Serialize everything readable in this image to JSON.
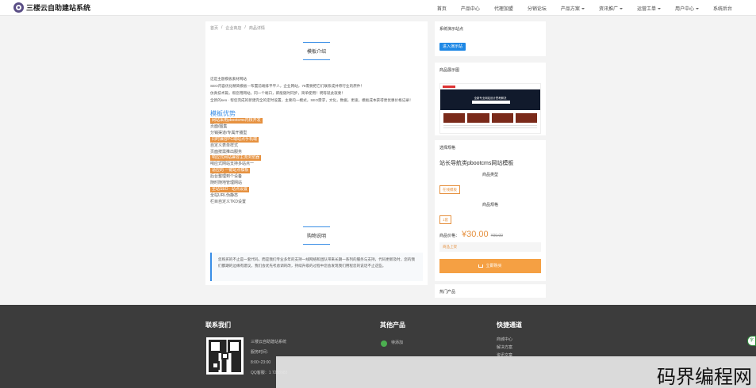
{
  "header": {
    "logo_text": "三楼云自助建站系统",
    "nav": [
      {
        "label": "首页",
        "dropdown": false
      },
      {
        "label": "产品中心",
        "dropdown": false
      },
      {
        "label": "代理加盟",
        "dropdown": false
      },
      {
        "label": "分销论坛",
        "dropdown": false
      },
      {
        "label": "产品方案",
        "dropdown": true
      },
      {
        "label": "资讯推广",
        "dropdown": true
      },
      {
        "label": "运营工单",
        "dropdown": true
      },
      {
        "label": "用户中心",
        "dropdown": true
      },
      {
        "label": "系统后台",
        "dropdown": false
      }
    ]
  },
  "breadcrumb": [
    "首页",
    "/",
    "企业商店",
    "/",
    "商品详情"
  ],
  "main": {
    "section1_title": "模板介绍",
    "intro_lines": [
      "这是主题模板素材网站",
      "SEO内容优化精简模板—布置前端排平平人，企业网站，75需要把它们联系成并称行业的原件！",
      "仿真技术篇，帮您用网站，同一个端口，即能随时同步，简单使用！明等就此就要！",
      "全新的seo · 帮您完成的新建完全的定时设置，主要的一模式，SEO需求，文化，数据，更速，模板成本获得更优惠价格记录！"
    ],
    "adv_title": "模板优势",
    "adv_items": [
      {
        "text": "网站采用pbootcms内核开发",
        "hl": true
      },
      {
        "text": "页面/图集",
        "hl": false
      },
      {
        "text": "分销渠道/专属开播型",
        "hl": false
      },
      {
        "text": "同时兼容PC端站点手机端",
        "hl": true
      },
      {
        "text": "自定义表单样式",
        "hl": false
      },
      {
        "text": "页面按需推出服务",
        "hl": false
      },
      {
        "text": "响应式网站兼容主流浏览器",
        "hl": true
      },
      {
        "text": "响应式网站支持多站点一",
        "hl": false
      },
      {
        "text": "适应的 一键站点模板",
        "hl": true
      },
      {
        "text": "后台整理到个设备",
        "hl": false
      },
      {
        "text": "随时随地管理网站",
        "hl": false
      },
      {
        "text": "全站SEO · 站点设置",
        "hl": true
      },
      {
        "text": "全站URL伪静态",
        "hl": false
      },
      {
        "text": "栏目自定义TKD设置",
        "hl": false
      }
    ],
    "section2_title": "购物说明",
    "notice_text": "您购买的不止是一套代码，而是我们专业多年的支持一线网络和团队带来长期一系列的服务与支持，代码更新及时，您的我们都期的边缘有建议，我们会优先考虑调的改，持续升级的过程中您会发现我们用程您的说话不止这些。"
  },
  "side_demo": {
    "title": "系统演示站点",
    "button": "进入演示站"
  },
  "side_image": {
    "title": "商品展示图",
    "hero_text": "全新专业网站设计思考解决"
  },
  "side_select": {
    "title": "选择规格",
    "product_name": "站长导航类pbootcms网站模板",
    "type_label": "商品类型",
    "type_tag": "在线模板",
    "spec_label": "商品规格",
    "spec_tag": "1套",
    "price_label": "商品价格：",
    "price": "¥30.00",
    "old_price": "¥99.00",
    "stock": "商品上架",
    "buy_button": "立即购买"
  },
  "side_hot": {
    "title": "热门产品"
  },
  "footer": {
    "contact_title": "联系我们",
    "contact_lines": [
      "三楼云自助建站系统",
      "服务时间：",
      "8:00~23:00",
      "QQ客服：1   7258983"
    ],
    "other_title": "其他产品",
    "other_item": "待添加",
    "quick_title": "快捷通道",
    "quick_items": [
      "商城中心",
      "解决方案",
      "资讯文章"
    ]
  },
  "float_button": "字",
  "watermark": "码界编程网",
  "colors": {
    "accent_blue": "#3a8ee6",
    "accent_orange": "#e6913f",
    "footer_bg": "#3c3c3c"
  }
}
